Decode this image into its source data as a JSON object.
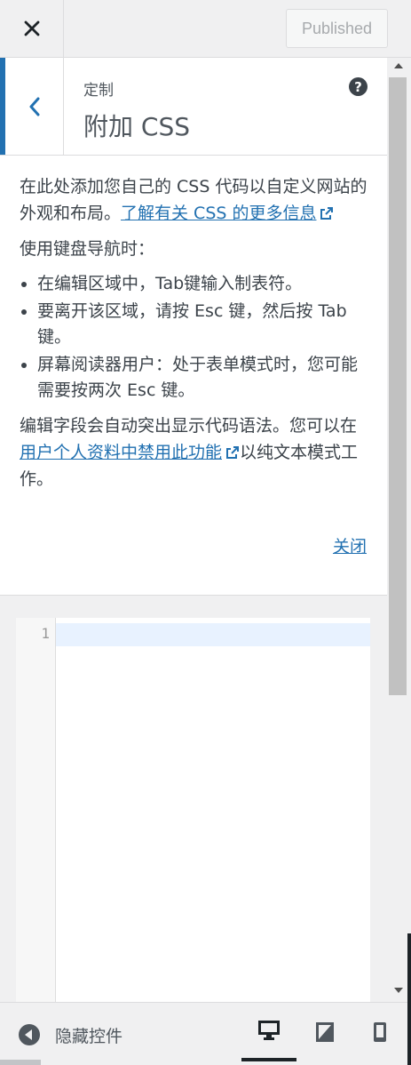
{
  "topbar": {
    "publish_label": "Published"
  },
  "section": {
    "subtitle": "定制",
    "title": "附加 CSS"
  },
  "description": {
    "intro_text": "在此处添加您自己的 CSS 代码以自定义网站的外观和布局。",
    "intro_link": "了解有关 CSS 的更多信息",
    "keyboard_heading": "使用键盘导航时：",
    "bullets": [
      "在编辑区域中，Tab键输入制表符。",
      "要离开该区域，请按 Esc 键，然后按 Tab 键。",
      "屏幕阅读器用户：处于表单模式时，您可能需要按两次 Esc 键。"
    ],
    "syntax_prefix": "编辑字段会自动突出显示代码语法。您可以在",
    "syntax_link": "用户个人资料中禁用此功能",
    "syntax_suffix": "以纯文本模式工作。",
    "close_label": "关闭"
  },
  "editor": {
    "line_number": "1",
    "content": ""
  },
  "footer": {
    "hide_label": "隐藏控件",
    "devices": [
      "desktop",
      "tablet",
      "mobile"
    ],
    "active_device": "desktop"
  },
  "colors": {
    "accent": "#2271b1",
    "text": "#3c434a",
    "border": "#dcdcde"
  }
}
